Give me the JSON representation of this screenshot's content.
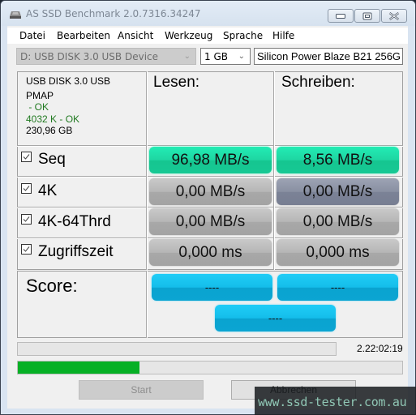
{
  "window": {
    "title": "AS SSD Benchmark 2.0.7316.34247",
    "icon": "drive-icon",
    "controls": [
      "minimize",
      "maximize",
      "close"
    ]
  },
  "menu": {
    "items": [
      {
        "label": "Datei"
      },
      {
        "label": "Bearbeiten"
      },
      {
        "label": "Ansicht"
      },
      {
        "label": "Werkzeug"
      },
      {
        "label": "Sprache"
      },
      {
        "label": "Hilfe"
      }
    ]
  },
  "toolbar": {
    "drive_select": "D: USB DISK 3.0 USB Device",
    "size_select": "1 GB",
    "device_name": "Silicon Power Blaze B21 256G"
  },
  "device_info": {
    "model": "USB DISK 3.0 USB",
    "driver": "PMAP",
    "driver_status": " - OK",
    "alignment": "4032 K - OK",
    "capacity": "230,96 GB"
  },
  "columns": {
    "read": "Lesen:",
    "write": "Schreiben:"
  },
  "rows": [
    {
      "label": "Seq",
      "checked": true,
      "read": "96,98 MB/s",
      "write": "8,56 MB/s",
      "read_state": "done",
      "write_state": "done"
    },
    {
      "label": "4K",
      "checked": true,
      "read": "0,00 MB/s",
      "write": "0,00 MB/s",
      "read_state": "pending",
      "write_state": "running"
    },
    {
      "label": "4K-64Thrd",
      "checked": true,
      "read": "0,00 MB/s",
      "write": "0,00 MB/s",
      "read_state": "pending",
      "write_state": "pending"
    },
    {
      "label": "Zugriffszeit",
      "checked": true,
      "read": "0,000 ms",
      "write": "0,000 ms",
      "read_state": "pending",
      "write_state": "pending"
    }
  ],
  "score": {
    "label": "Score:",
    "read": "----",
    "write": "----",
    "total": "----"
  },
  "progress": {
    "test_progress_percent": 0,
    "elapsed_time": "2.22:02:19",
    "overall_progress_percent": 31.6,
    "fill_color": "#06b025"
  },
  "buttons": {
    "start": "Start",
    "cancel": "Abbrechen"
  },
  "watermark": {
    "text": "www.ssd-tester.com.au"
  },
  "colors": {
    "result_done": "#1ed6a2",
    "result_pending": "#b6b6b6",
    "result_running": "#8990a2",
    "score": "#14bdea"
  }
}
